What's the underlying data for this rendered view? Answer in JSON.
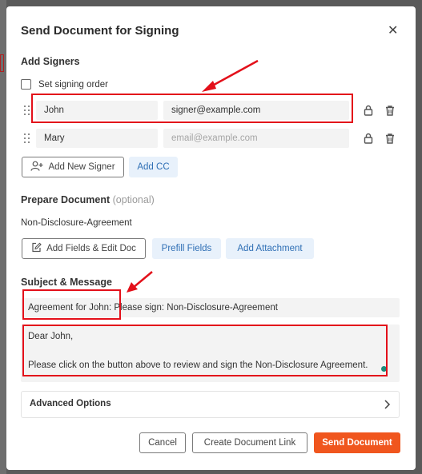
{
  "dialog": {
    "title": "Send Document for Signing",
    "close_glyph": "✕"
  },
  "signers_section": {
    "heading": "Add Signers",
    "signing_order_label": "Set signing order",
    "signing_order_checked": false,
    "signers": [
      {
        "name": "John",
        "email": "signer@example.com",
        "email_is_placeholder": false
      },
      {
        "name": "Mary",
        "email": "email@example.com",
        "email_is_placeholder": true
      }
    ],
    "add_signer_label": "Add New Signer",
    "add_cc_label": "Add CC"
  },
  "prepare_section": {
    "heading": "Prepare Document",
    "heading_suffix": "(optional)",
    "document_name": "Non-Disclosure-Agreement",
    "edit_fields_label": "Add Fields & Edit Doc",
    "prefill_label": "Prefill Fields",
    "attachment_label": "Add Attachment"
  },
  "message_section": {
    "heading": "Subject & Message",
    "subject": "Agreement for John: Please sign: Non-Disclosure-Agreement",
    "message_line1": "Dear John,",
    "message_line2": "Please click on the button above to review and sign the Non-Disclosure Agreement."
  },
  "advanced_options_label": "Advanced Options",
  "footer": {
    "cancel_label": "Cancel",
    "create_link_label": "Create Document Link",
    "send_label": "Send Document"
  },
  "colors": {
    "primary": "#f0561e",
    "soft_button_bg": "#e8f1fb",
    "soft_button_text": "#2f6fb5",
    "annotation": "#e3101a"
  },
  "icons": [
    "close-icon",
    "drag-handle-icon",
    "lock-icon",
    "trash-icon",
    "add-user-icon",
    "edit-icon",
    "chevron-right-icon"
  ]
}
